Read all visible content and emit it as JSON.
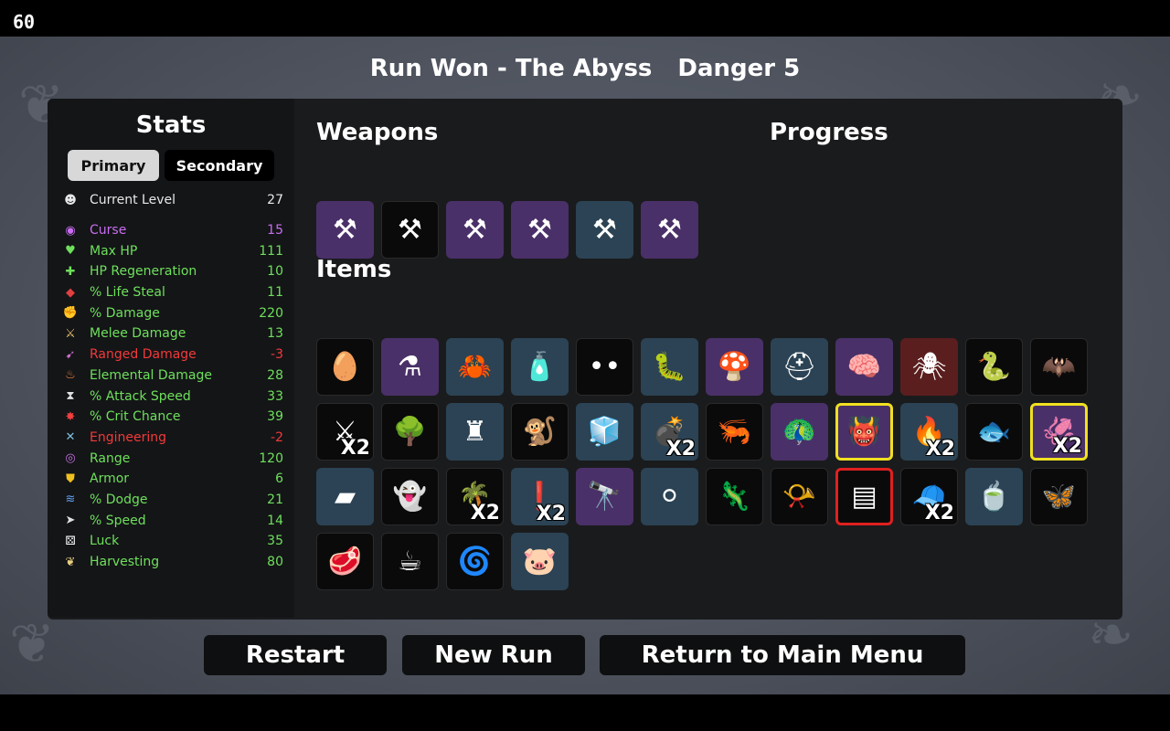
{
  "fps": "60",
  "header": {
    "run_status": "Run Won - The Abyss",
    "danger": "Danger 5"
  },
  "stats": {
    "title": "Stats",
    "tabs": {
      "primary": "Primary",
      "secondary": "Secondary"
    },
    "level": {
      "name": "Current Level",
      "value": "27",
      "icon": "☻"
    },
    "rows": [
      {
        "name": "Curse",
        "value": "15",
        "color": "purple",
        "icon": "◉",
        "icon_color": "#c86ef0"
      },
      {
        "name": "Max HP",
        "value": "111",
        "color": "green",
        "icon": "♥",
        "icon_color": "#6ee05c"
      },
      {
        "name": "HP Regeneration",
        "value": "10",
        "color": "green",
        "icon": "✚",
        "icon_color": "#6ee05c"
      },
      {
        "name": "% Life Steal",
        "value": "11",
        "color": "green",
        "icon": "◆",
        "icon_color": "#e04040"
      },
      {
        "name": "% Damage",
        "value": "220",
        "color": "green",
        "icon": "✊",
        "icon_color": "#f06060"
      },
      {
        "name": "Melee Damage",
        "value": "13",
        "color": "green",
        "icon": "⚔",
        "icon_color": "#e8c070"
      },
      {
        "name": "Ranged Damage",
        "value": "-3",
        "color": "red",
        "icon": "➹",
        "icon_color": "#d070d0"
      },
      {
        "name": "Elemental Damage",
        "value": "28",
        "color": "green",
        "icon": "♨",
        "icon_color": "#f08040"
      },
      {
        "name": "% Attack Speed",
        "value": "33",
        "color": "green",
        "icon": "⧗",
        "icon_color": "#e0e0e0"
      },
      {
        "name": "% Crit Chance",
        "value": "39",
        "color": "green",
        "icon": "✸",
        "icon_color": "#f04040"
      },
      {
        "name": "Engineering",
        "value": "-2",
        "color": "red",
        "icon": "✕",
        "icon_color": "#80c0e0"
      },
      {
        "name": "Range",
        "value": "120",
        "color": "green",
        "icon": "◎",
        "icon_color": "#c070e0"
      },
      {
        "name": "Armor",
        "value": "6",
        "color": "green",
        "icon": "⛊",
        "icon_color": "#f0c020"
      },
      {
        "name": "% Dodge",
        "value": "21",
        "color": "green",
        "icon": "≋",
        "icon_color": "#60a0f0"
      },
      {
        "name": "% Speed",
        "value": "14",
        "color": "green",
        "icon": "➤",
        "icon_color": "#e0e0e0"
      },
      {
        "name": "Luck",
        "value": "35",
        "color": "green",
        "icon": "⚄",
        "icon_color": "#ffffff"
      },
      {
        "name": "Harvesting",
        "value": "80",
        "color": "green",
        "icon": "❦",
        "icon_color": "#e8d080"
      }
    ]
  },
  "weapons": {
    "title": "Weapons",
    "items": [
      {
        "name": "fork-weapon-icon",
        "glyph": "⚒",
        "tier": 2
      },
      {
        "name": "fork-weapon-icon",
        "glyph": "⚒",
        "tier": 0
      },
      {
        "name": "fork-weapon-icon",
        "glyph": "⚒",
        "tier": 2
      },
      {
        "name": "fork-weapon-icon",
        "glyph": "⚒",
        "tier": 2
      },
      {
        "name": "fork-weapon-icon",
        "glyph": "⚒",
        "tier": 1
      },
      {
        "name": "fork-weapon-icon",
        "glyph": "⚒",
        "tier": 2
      }
    ]
  },
  "progress": {
    "title": "Progress"
  },
  "items": {
    "title": "Items",
    "list": [
      {
        "name": "egg-icon",
        "glyph": "🥚",
        "tier": 0
      },
      {
        "name": "potion-machine-icon",
        "glyph": "⚗",
        "tier": 2
      },
      {
        "name": "claw-icon",
        "glyph": "🦀",
        "tier": 1
      },
      {
        "name": "ketchup-bottle-icon",
        "glyph": "🧴",
        "tier": 1
      },
      {
        "name": "dark-eyes-icon",
        "glyph": "••",
        "tier": 0
      },
      {
        "name": "larva-icon",
        "glyph": "🐛",
        "tier": 1
      },
      {
        "name": "mushrooms-icon",
        "glyph": "🍄",
        "tier": 2
      },
      {
        "name": "helmet-icon",
        "glyph": "⛑",
        "tier": 1
      },
      {
        "name": "brain-creature-icon",
        "glyph": "🧠",
        "tier": 2
      },
      {
        "name": "spider-icon",
        "glyph": "🕷",
        "tier": 3
      },
      {
        "name": "snake-icon",
        "glyph": "🐍",
        "tier": 0
      },
      {
        "name": "bat-icon",
        "glyph": "🦇",
        "tier": 0
      },
      {
        "name": "scythe-icon",
        "glyph": "⚔",
        "tier": 0,
        "qty": "X2"
      },
      {
        "name": "tree-icon",
        "glyph": "🌳",
        "tier": 0
      },
      {
        "name": "ruins-icon",
        "glyph": "♜",
        "tier": 1
      },
      {
        "name": "monkey-icon",
        "glyph": "🐒",
        "tier": 0
      },
      {
        "name": "ice-cube-icon",
        "glyph": "🧊",
        "tier": 1
      },
      {
        "name": "grenade-icon",
        "glyph": "💣",
        "tier": 1,
        "qty": "X2"
      },
      {
        "name": "shrimp-icon",
        "glyph": "🦐",
        "tier": 0
      },
      {
        "name": "peacock-icon",
        "glyph": "🦚",
        "tier": 2
      },
      {
        "name": "demon-mask-icon",
        "glyph": "👹",
        "tier": 2,
        "highlight": "yellow"
      },
      {
        "name": "campfire-icon",
        "glyph": "🔥",
        "tier": 1,
        "qty": "X2"
      },
      {
        "name": "fish-icon",
        "glyph": "🐟",
        "tier": 0
      },
      {
        "name": "tentacle-icon",
        "glyph": "🦑",
        "tier": 2,
        "qty": "X2",
        "highlight": "yellow"
      },
      {
        "name": "plank-icon",
        "glyph": "▰",
        "tier": 1
      },
      {
        "name": "ghost-icon",
        "glyph": "👻",
        "tier": 0
      },
      {
        "name": "palm-plant-icon",
        "glyph": "🌴",
        "tier": 0,
        "qty": "X2"
      },
      {
        "name": "alert-creature-icon",
        "glyph": "❗",
        "tier": 1,
        "qty": "X2"
      },
      {
        "name": "cannon-icon",
        "glyph": "🔭",
        "tier": 2
      },
      {
        "name": "snowball-icon",
        "glyph": "⚪",
        "tier": 1
      },
      {
        "name": "lizard-icon",
        "glyph": "🦎",
        "tier": 0
      },
      {
        "name": "whistle-icon",
        "glyph": "📯",
        "tier": 0
      },
      {
        "name": "mossy-plank-icon",
        "glyph": "▤",
        "tier": 0,
        "highlight": "red"
      },
      {
        "name": "propeller-hat-icon",
        "glyph": "🧢",
        "tier": 0,
        "qty": "X2"
      },
      {
        "name": "tea-cup-icon",
        "glyph": "🍵",
        "tier": 1
      },
      {
        "name": "butterfly-icon",
        "glyph": "🦋",
        "tier": 0
      },
      {
        "name": "meat-icon",
        "glyph": "🥩",
        "tier": 0
      },
      {
        "name": "coffee-cup-icon",
        "glyph": "☕",
        "tier": 0
      },
      {
        "name": "spiral-creature-icon",
        "glyph": "🌀",
        "tier": 0
      },
      {
        "name": "piggy-bank-icon",
        "glyph": "🐷",
        "tier": 1
      }
    ]
  },
  "buttons": {
    "restart": "Restart",
    "new_run": "New Run",
    "main_menu": "Return to Main Menu"
  }
}
